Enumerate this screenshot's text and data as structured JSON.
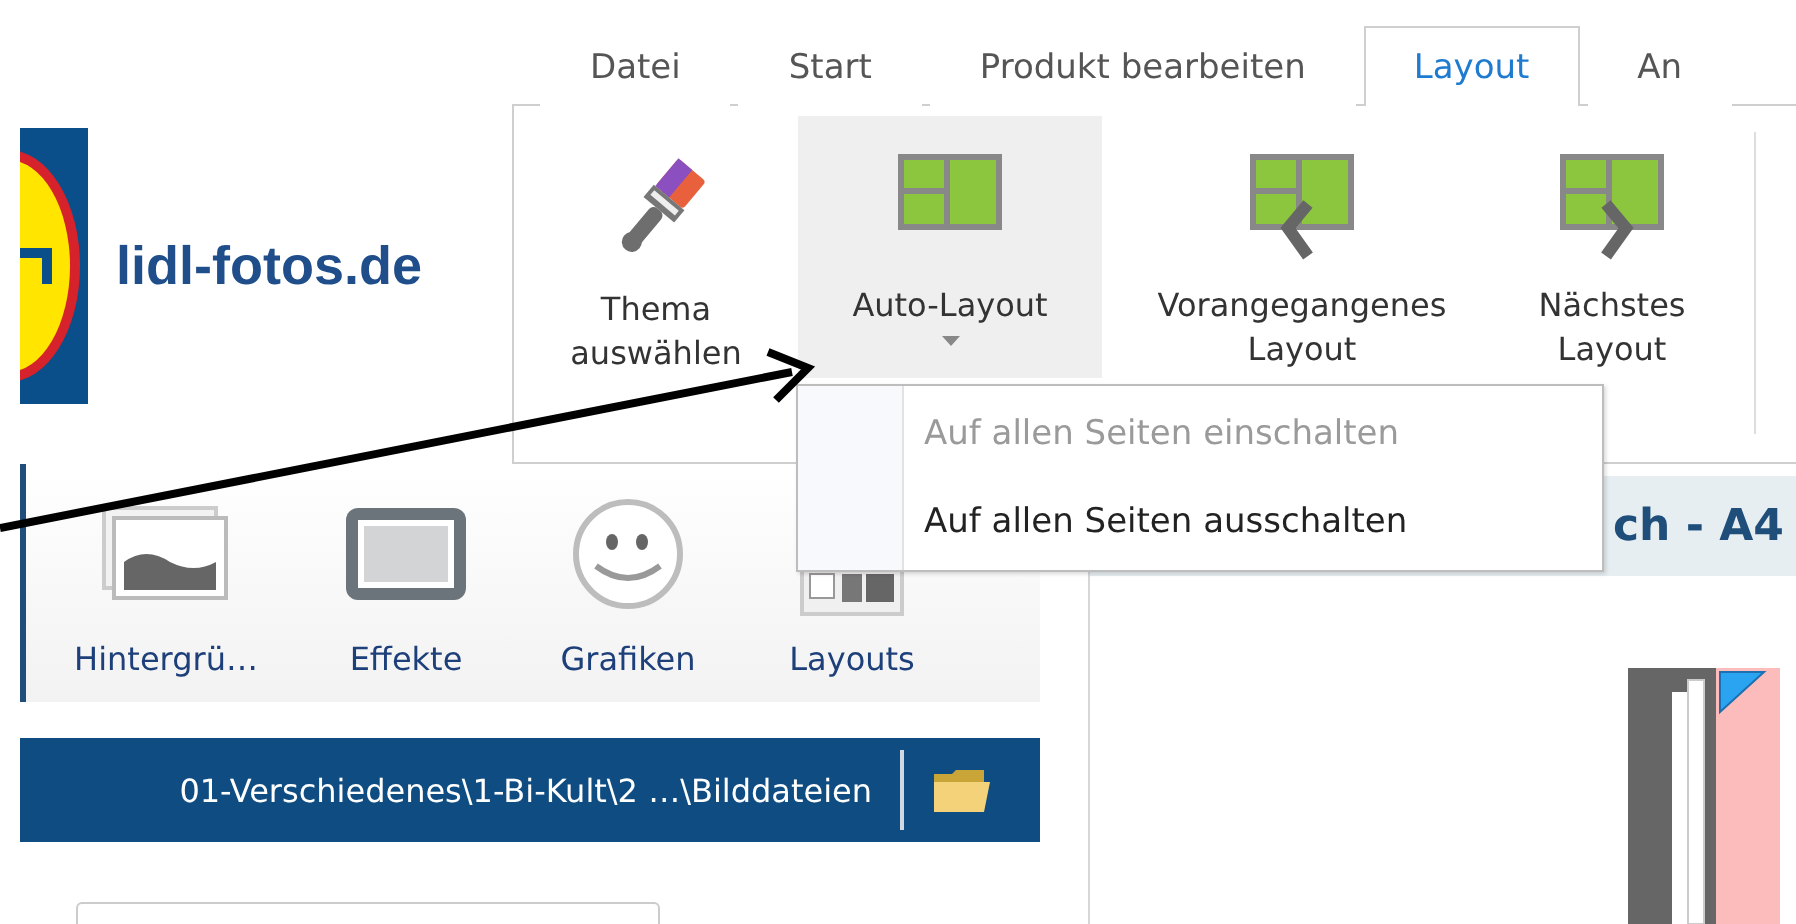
{
  "logo": {
    "text": "lidl-fotos.de"
  },
  "tabs": [
    {
      "label": "Datei",
      "selected": false
    },
    {
      "label": "Start",
      "selected": false
    },
    {
      "label": "Produkt bearbeiten",
      "selected": false
    },
    {
      "label": "Layout",
      "selected": true
    },
    {
      "label": "An",
      "selected": false
    }
  ],
  "ribbon": {
    "buttons": [
      {
        "label": "Thema auswählen",
        "kind": "brush",
        "pressed": false,
        "dropdown": false
      },
      {
        "label": "Auto-Layout",
        "kind": "auto",
        "pressed": true,
        "dropdown": true
      },
      {
        "label": "Vorangegangenes Layout",
        "kind": "prev",
        "pressed": false,
        "dropdown": false
      },
      {
        "label": "Nächstes Layout",
        "kind": "next",
        "pressed": false,
        "dropdown": false
      }
    ]
  },
  "dropdown_menu": {
    "items": [
      {
        "label": "Auf allen Seiten einschalten",
        "disabled": true
      },
      {
        "label": "Auf allen Seiten ausschalten",
        "disabled": false
      }
    ]
  },
  "tools": [
    {
      "label": "Hintergrü…",
      "kind": "background"
    },
    {
      "label": "Effekte",
      "kind": "frame"
    },
    {
      "label": "Grafiken",
      "kind": "smiley"
    },
    {
      "label": "Layouts",
      "kind": "layouts"
    }
  ],
  "path_bar": {
    "path": "01-Verschiedenes\\1-Bi-Kult\\2 …\\Bilddateien"
  },
  "project_header": {
    "title": "ch - A4"
  }
}
